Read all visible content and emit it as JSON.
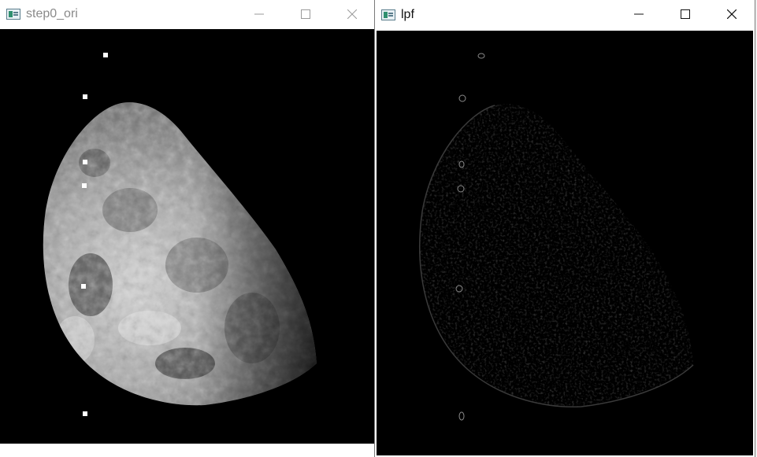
{
  "windows": {
    "left": {
      "title": "step0_ori",
      "icon": "opencv-window-icon"
    },
    "right": {
      "title": "lpf",
      "icon": "opencv-window-icon"
    }
  },
  "controls": {
    "minimize": "minimize-icon",
    "maximize": "maximize-icon",
    "close": "close-icon"
  },
  "colors": {
    "image_background": "#000000",
    "titlebar": "#ffffff",
    "inactive_title": "#8a8a8a",
    "active_title": "#111111"
  }
}
